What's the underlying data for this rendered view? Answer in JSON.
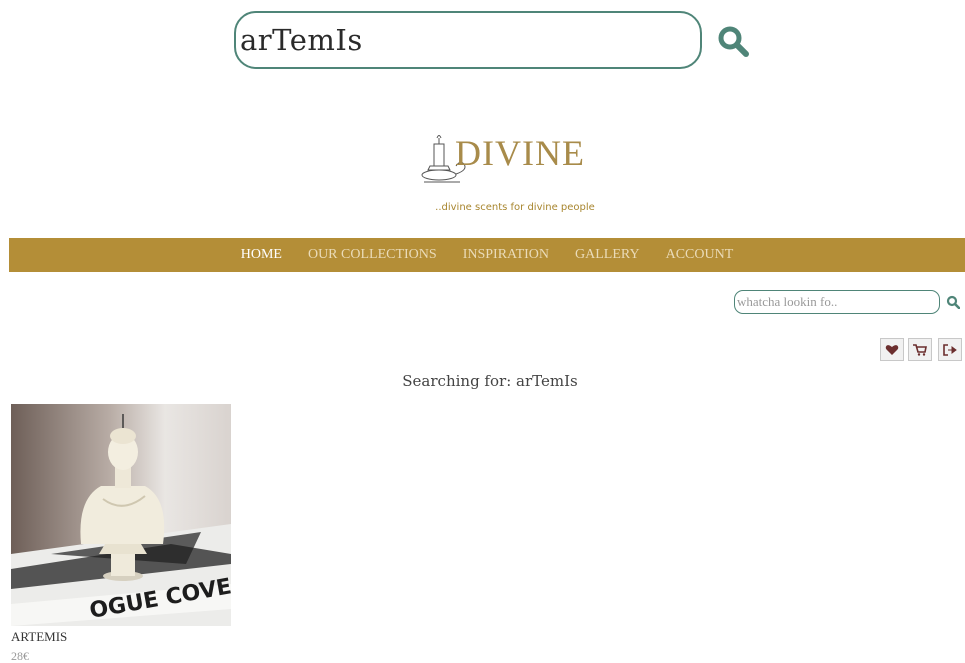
{
  "header": {
    "search_value": "arTemIs",
    "search_icon": "search-icon"
  },
  "brand": {
    "logo_text": "DIVINE",
    "tagline": "..divine scents for divine people"
  },
  "nav": {
    "items": [
      "HOME",
      "OUR COLLECTIONS",
      "INSPIRATION",
      "GALLERY",
      "ACCOUNT"
    ],
    "active": "HOME"
  },
  "mini_search": {
    "placeholder": "whatcha lookin fo.."
  },
  "toolbar": {
    "icons": [
      "heart-icon",
      "cart-icon",
      "logout-icon"
    ]
  },
  "results": {
    "heading": "Searching for: arTemIs",
    "products": [
      {
        "name": "ARTEMIS",
        "price": "28€"
      }
    ]
  },
  "colors": {
    "accent_teal": "#4f8578",
    "nav_gold": "#b48e37",
    "logo_gold": "#a88b4a",
    "icon_brown": "#6b2e2e"
  }
}
